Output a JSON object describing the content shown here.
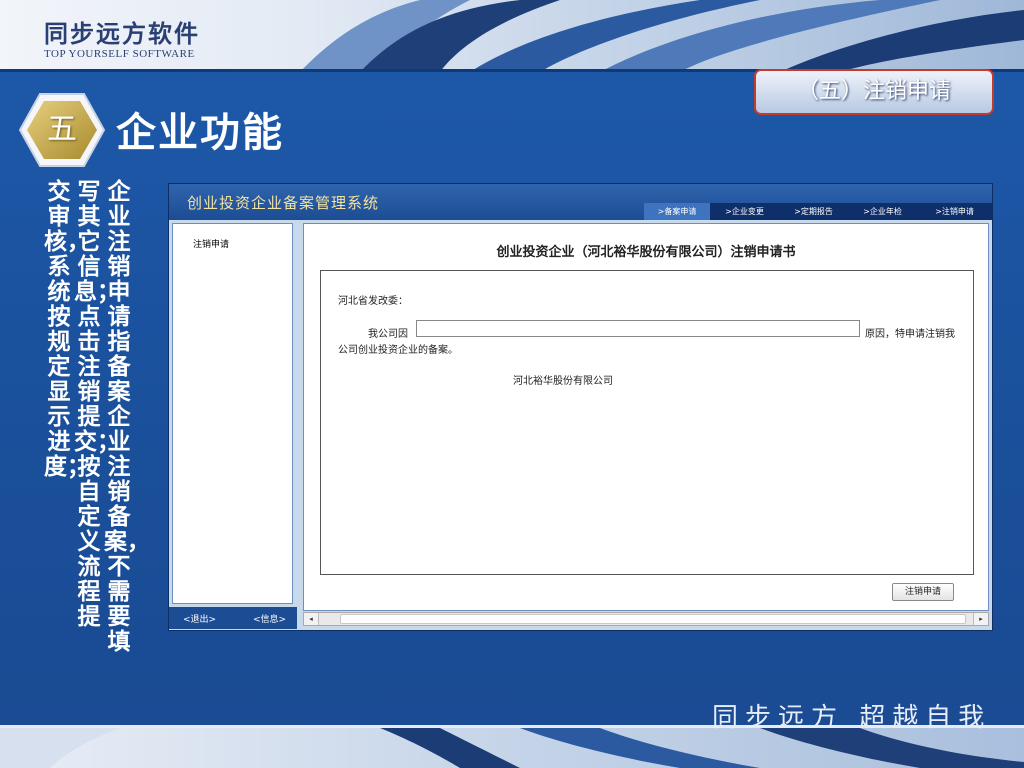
{
  "brand": {
    "name_cn": "同步远方软件",
    "name_en": "TOP YOURSELF SOFTWARE"
  },
  "section": {
    "tag": "（五）注销申请",
    "number": "五",
    "title": "企业功能"
  },
  "description": {
    "columns": [
      "企业注销申请指备案企业注销备案，不需要填",
      "写其它信息；点击注销提交；按自定义流程提",
      "交审核，系统按规定显示进度；"
    ]
  },
  "app": {
    "title": "创业投资企业备案管理系统",
    "nav": [
      {
        "label": ">备案申请"
      },
      {
        "label": ">企业变更"
      },
      {
        "label": ">定期报告"
      },
      {
        "label": ">企业年检"
      },
      {
        "label": ">注销申请"
      }
    ],
    "sidebar": {
      "items": [
        {
          "label": "注销申请"
        }
      ],
      "exit_label": "<退出>",
      "info_label": "<信息>"
    },
    "form": {
      "title": "创业投资企业（河北裕华股份有限公司）注销申请书",
      "addressee": "河北省发改委：",
      "reason_prefix": "我公司因",
      "reason_value": "",
      "reason_suffix": "原因，特申请注销我",
      "reason_cont": "公司创业投资企业的备案。",
      "company": "河北裕华股份有限公司",
      "submit_label": "注销申请"
    }
  },
  "slogan": "同步远方  超越自我",
  "colors": {
    "slide_bg": "#1a4f9a",
    "accent_red": "#c23b2c",
    "hex_gold": "#c9a544",
    "app_title_text": "#f4e3a0"
  }
}
